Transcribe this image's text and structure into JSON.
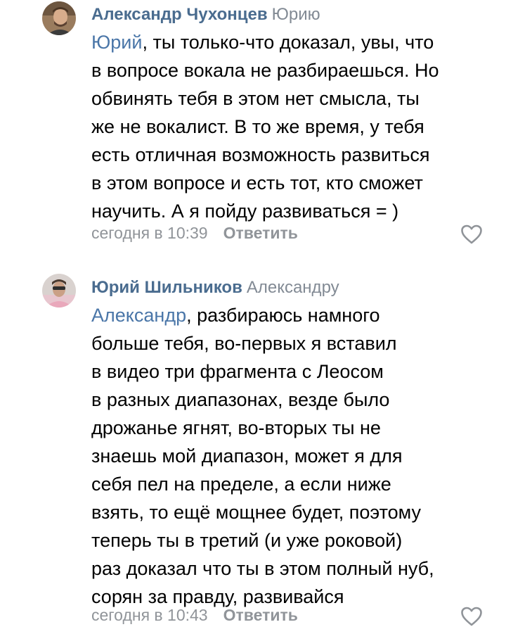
{
  "comments": [
    {
      "author": "Александр Чухонцев",
      "reply_to": "Юрию",
      "mention": "Юрий",
      "lines": [
        ", ты только-что доказал, увы, что",
        "в вопросе вокала не разбираешься. Но",
        "обвинять тебя в этом нет смысла, ты",
        "же не вокалист. В то же время, у тебя",
        "есть отличная возможность развиться",
        "в этом вопросе и есть тот, кто сможет",
        "научить. А я пойду развиваться = )"
      ],
      "time": "сегодня в 10:39",
      "reply_label": "Ответить",
      "like_icon": "heart-outline-icon"
    },
    {
      "author": "Юрий Шильников",
      "reply_to": "Александру",
      "mention": "Александр",
      "lines": [
        ", разбираюсь намного",
        "больше тебя, во-первых я вставил",
        "в видео три фрагмента с Леосом",
        "в разных диапазонах, везде было",
        "дрожанье ягнят, во-вторых ты не",
        "знаешь мой диапазон, может я для",
        "себя пел на пределе, а если ниже",
        "взять, то ещё мощнее будет, поэтому",
        "теперь ты в третий (и уже роковой)",
        "раз доказал что ты в этом полный нуб,",
        "сорян за правду, развивайся"
      ],
      "time": "сегодня в 10:43",
      "reply_label": "Ответить",
      "like_icon": "heart-outline-icon"
    }
  ],
  "colors": {
    "author": "#4a6c8f",
    "mention": "#4a76a8",
    "secondary": "#909499",
    "reply_to": "#828a94"
  }
}
